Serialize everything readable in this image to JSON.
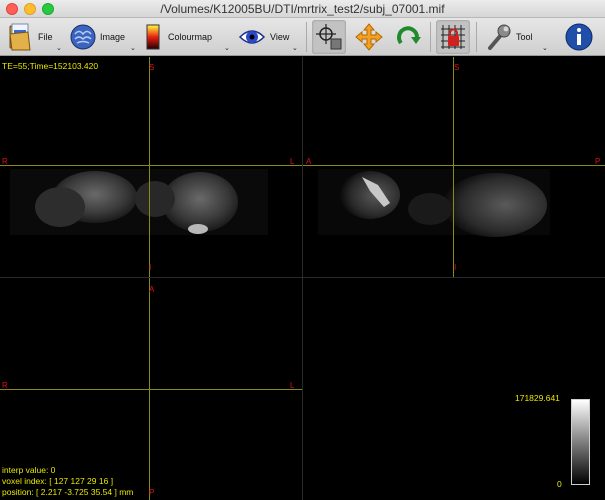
{
  "window": {
    "title": "/Volumes/K12005BU/DTI/mrtrix_test2/subj_07001.mif"
  },
  "toolbar": {
    "file_label": "File",
    "image_label": "Image",
    "colourmap_label": "Colourmap",
    "view_label": "View",
    "tool_label": "Tool",
    "dropdown_glyph": "⌄"
  },
  "overlay": {
    "te_time": "TE=55;Time=152103.420",
    "interp_value": "interp value: 0",
    "voxel_index": "voxel index: [ 127 127 29 16 ]",
    "position": "position: [ 2.217 -3.725 35.54 ] mm"
  },
  "orientation": {
    "axial": {
      "top": "S",
      "bottom": "I",
      "left": "R",
      "right": "L"
    },
    "sagittal": {
      "top": "S",
      "bottom": "I",
      "left": "A",
      "right": "P"
    },
    "coronal": {
      "top": "A",
      "bottom": "P",
      "left": "R",
      "right": "L"
    }
  },
  "colorbar": {
    "max_label": "171829.641",
    "min_label": "0"
  },
  "colors": {
    "crosshair": "#8a8a1a",
    "orientation_label": "#e01010",
    "overlay_text": "#e8e800"
  }
}
